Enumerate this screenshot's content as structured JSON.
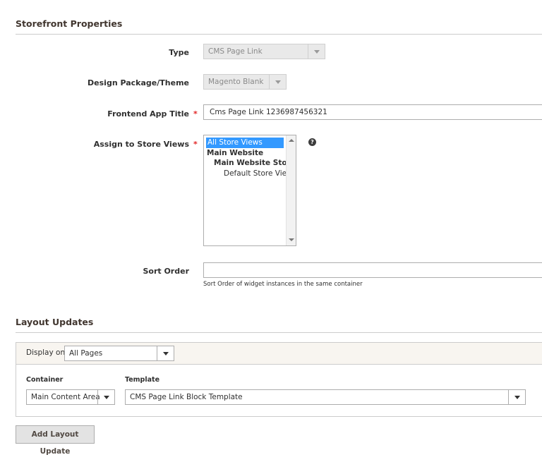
{
  "storefront": {
    "title": "Storefront Properties",
    "type": {
      "label": "Type",
      "value": "CMS Page Link"
    },
    "design": {
      "label": "Design Package/Theme",
      "value": "Magento Blank"
    },
    "frontend_title": {
      "label": "Frontend App Title",
      "value": "Cms Page Link 1236987456321",
      "required_mark": "*"
    },
    "store_views": {
      "label": "Assign to Store Views",
      "required_mark": "*",
      "help": "?",
      "options": [
        {
          "text": "All Store Views",
          "selected": true,
          "bold": false
        },
        {
          "text": "Main Website",
          "selected": false,
          "bold": true
        },
        {
          "text": "Main Website Store",
          "selected": false,
          "bold": true
        },
        {
          "text": "Default Store View",
          "selected": false,
          "bold": false
        }
      ]
    },
    "sort_order": {
      "label": "Sort Order",
      "value": "",
      "note": "Sort Order of widget instances in the same container"
    }
  },
  "layout_updates": {
    "title": "Layout Updates",
    "display_on": {
      "label": "Display on",
      "value": "All Pages"
    },
    "container": {
      "label": "Container",
      "value": "Main Content Area"
    },
    "template": {
      "label": "Template",
      "value": "CMS Page Link Block Template"
    },
    "add_button": "Add Layout Update"
  },
  "colors": {
    "selected_option_bg": "#3399ff",
    "required_mark": "#e22626",
    "panel_header_bg": "#f8f5f0",
    "button_bg": "#e3e3e3"
  }
}
